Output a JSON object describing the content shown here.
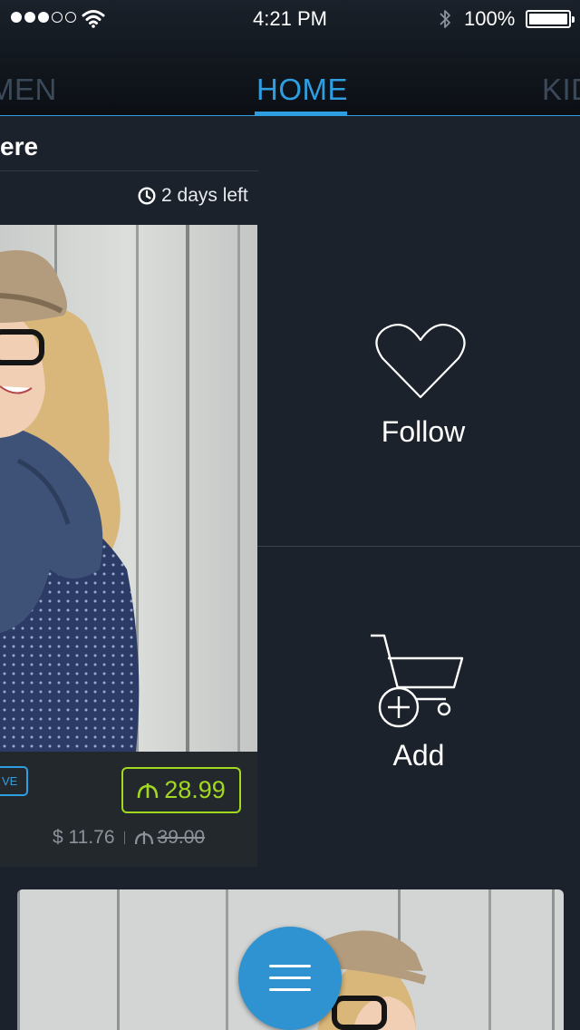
{
  "status_bar": {
    "time": "4:21 PM",
    "battery": "100%",
    "icons": [
      "signal-dots-icon",
      "wifi-icon",
      "bluetooth-icon",
      "battery-icon"
    ]
  },
  "tabs": [
    {
      "label": "MEN",
      "active": false
    },
    {
      "label": "HOME",
      "active": true
    },
    {
      "label": "KID",
      "active": false
    }
  ],
  "event": {
    "title": "ere",
    "time_left": "2 days left"
  },
  "product": {
    "badge": "VE",
    "price": "28.99",
    "alt_price": "$ 11.76",
    "original_price": "39.00"
  },
  "actions": {
    "follow_label": "Follow",
    "add_label": "Add"
  },
  "colors": {
    "accent": "#2f9ee0",
    "price_green": "#a2d81f",
    "background": "#1b222b"
  }
}
